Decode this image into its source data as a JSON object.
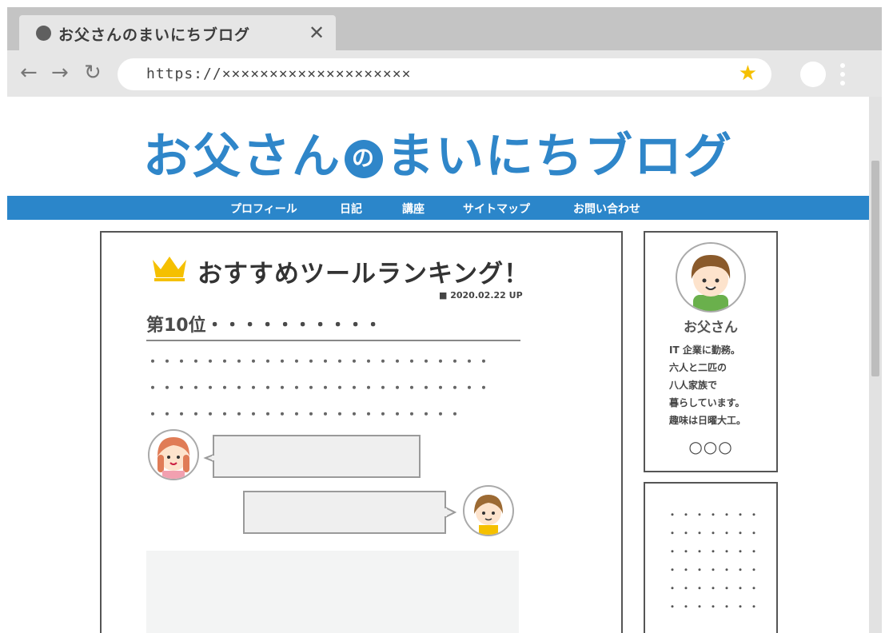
{
  "tab": {
    "title": "お父さんのまいにちブログ",
    "close_label": "✕"
  },
  "toolbar": {
    "back": "←",
    "forward": "→",
    "reload": "↻",
    "url": "https://××××××××××××××××××××",
    "bookmark_star": "★"
  },
  "site": {
    "title_part1": "お父さん",
    "title_no": "の",
    "title_part2": "まいにちブログ"
  },
  "nav": [
    "プロフィール",
    "日記",
    "講座",
    "サイトマップ",
    "お問い合わせ"
  ],
  "post": {
    "title": "おすすめツールランキング！",
    "date": "■ 2020.02.22 UP",
    "rank_heading": "第10位・・・・・・・・・・",
    "dot_lines": [
      "・・・・・・・・・・・・・・・・・・・・・・・・",
      "・・・・・・・・・・・・・・・・・・・・・・・・",
      "・・・・・・・・・・・・・・・・・・・・・・"
    ]
  },
  "profile": {
    "name": "お父さん",
    "bio": [
      "IT 企業に勤務。",
      "六人と二匹の",
      "八人家族で",
      "暮らしています。",
      "趣味は日曜大工。"
    ],
    "circles": "○○○"
  },
  "widget": {
    "dot_rows": [
      "・・・・・・・",
      "・・・・・・・",
      "・・・・・・・",
      "・・・・・・・",
      "・・・・・・・",
      "・・・・・・・"
    ]
  },
  "colors": {
    "accent": "#2b86ca",
    "crown": "#f5c000"
  },
  "icons": [
    "back-icon",
    "forward-icon",
    "reload-icon",
    "star-icon",
    "close-icon",
    "crown-icon",
    "menu-dots-icon"
  ]
}
